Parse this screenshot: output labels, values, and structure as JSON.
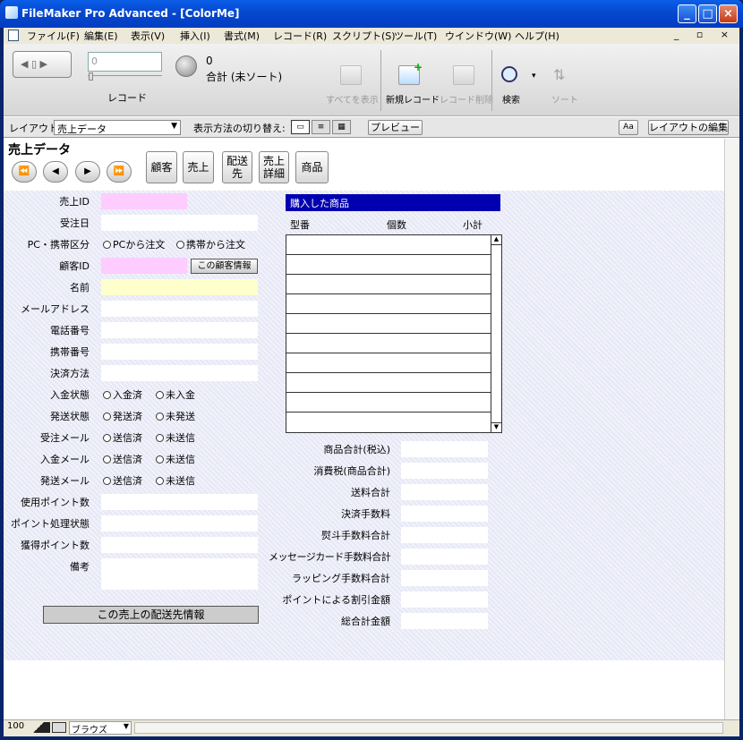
{
  "window": {
    "title": "FileMaker Pro Advanced - [ColorMe]"
  },
  "menubar": {
    "items": [
      "ファイル(F)",
      "編集(E)",
      "表示(V)",
      "挿入(I)",
      "書式(M)",
      "レコード(R)",
      "スクリプト(S)",
      "ツール(T)",
      "ウインドウ(W)",
      "ヘルプ(H)"
    ]
  },
  "toolbar": {
    "record_input_value": "0",
    "record_label": "レコード",
    "found_count": "0",
    "found_status": "合計 (未ソート)",
    "show_all": "すべてを表示",
    "new_record": "新規レコード",
    "delete_record": "レコード削除",
    "find": "検索",
    "sort": "ソート"
  },
  "layoutbar": {
    "layout_label": "レイアウト:",
    "layout_value": "売上データ",
    "view_label": "表示方法の切り替え:",
    "preview": "プレビュー",
    "aa": "Aa",
    "edit_layout": "レイアウトの編集"
  },
  "form": {
    "title": "売上データ",
    "nav_buttons": [
      "◀◀",
      "◀",
      "▶",
      "▶▶"
    ],
    "nav_buttons_display": [
      "⏪",
      "◀",
      "▶",
      "⏩"
    ],
    "nav_buttons_names": [
      "first-record",
      "prev-record",
      "next-record",
      "last-record"
    ],
    "tab_buttons": [
      "顧客",
      "売上",
      "配送先",
      "売上詳細",
      "商品"
    ],
    "fields": {
      "sales_id": "売上ID",
      "order_date": "受注日",
      "pc_mobile": "PC・携帯区分",
      "customer_id": "顧客ID",
      "name": "名前",
      "email": "メールアドレス",
      "phone": "電話番号",
      "mobile": "携帯番号",
      "payment": "決済方法",
      "payment_status": "入金状態",
      "ship_status": "発送状態",
      "order_mail": "受注メール",
      "payment_mail": "入金メール",
      "ship_mail": "発送メール",
      "points_used": "使用ポイント数",
      "points_status": "ポイント処理状態",
      "points_earned": "獲得ポイント数",
      "note": "備考"
    },
    "radios": {
      "pc": "PCから注文",
      "mobile": "携帯から注文",
      "paid": "入金済",
      "unpaid": "未入金",
      "shipped": "発送済",
      "unshipped": "未発送",
      "sent": "送信済",
      "unsent": "未送信"
    },
    "customer_info_button": "この顧客情報",
    "ship_info_button": "この売上の配送先情報",
    "portal": {
      "header": "購入した商品",
      "columns": [
        "型番",
        "個数",
        "小計"
      ],
      "row_count": 10
    },
    "totals": [
      "商品合計(税込)",
      "消費税(商品合計)",
      "送料合計",
      "決済手数料",
      "熨斗手数料合計",
      "メッセージカード手数料合計",
      "ラッピング手数料合計",
      "ポイントによる割引金額",
      "総合計金額"
    ]
  },
  "statusbar": {
    "zoom": "100",
    "mode": "ブラウズ"
  }
}
